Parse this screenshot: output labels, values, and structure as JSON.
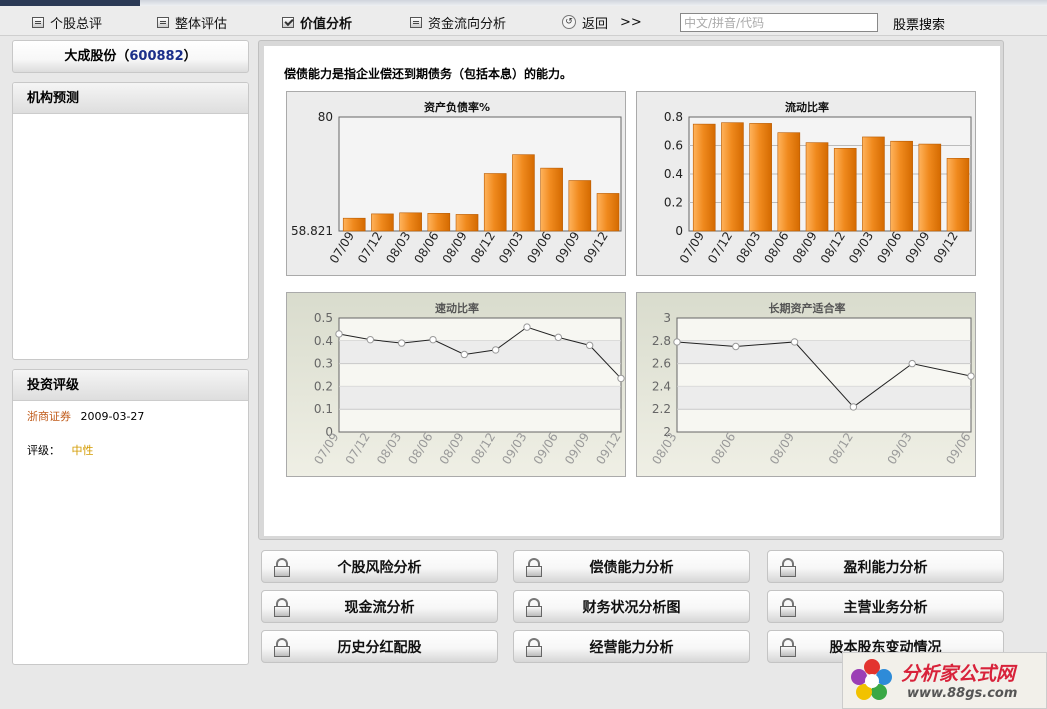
{
  "nav": {
    "items": [
      {
        "label": "个股总评"
      },
      {
        "label": "整体评估"
      },
      {
        "label": "价值分析",
        "active": true
      },
      {
        "label": "资金流向分析"
      },
      {
        "label": "返回"
      }
    ],
    "back_arrows": ">>",
    "search_placeholder": "中文/拼音/代码",
    "search_button": "股票搜索"
  },
  "stock": {
    "name": "大成股份",
    "code": "600882"
  },
  "institution_forecast": {
    "title": "机构预测"
  },
  "investment_rating": {
    "title": "投资评级",
    "broker": "浙商证券",
    "date": "2009-03-27",
    "rating_label": "评级：",
    "rating_value": "中性"
  },
  "intro_text": "偿债能力是指企业偿还到期债务（包括本息）的能力。",
  "chart_data": [
    {
      "type": "bar",
      "title": "资产负债率%",
      "categories": [
        "07/09",
        "07/12",
        "08/03",
        "08/06",
        "08/09",
        "08/12",
        "09/03",
        "09/06",
        "09/09",
        "09/12"
      ],
      "values": [
        61.2,
        62.0,
        62.2,
        62.1,
        61.9,
        69.5,
        73.0,
        70.5,
        68.2,
        65.8
      ],
      "ylim": [
        58.821,
        80
      ],
      "yticks": [
        "80",
        "58.821"
      ],
      "color": "#f08a1e"
    },
    {
      "type": "bar",
      "title": "流动比率",
      "categories": [
        "07/09",
        "07/12",
        "08/03",
        "08/06",
        "08/09",
        "08/12",
        "09/03",
        "09/06",
        "09/09",
        "09/12"
      ],
      "values": [
        0.75,
        0.76,
        0.755,
        0.69,
        0.62,
        0.58,
        0.66,
        0.63,
        0.61,
        0.51
      ],
      "ylim": [
        0,
        0.8
      ],
      "yticks": [
        "0.8",
        "0.6",
        "0.4",
        "0.2",
        "0"
      ],
      "color": "#f08a1e"
    },
    {
      "type": "line",
      "title": "速动比率",
      "categories": [
        "07/09",
        "07/12",
        "08/03",
        "08/06",
        "08/09",
        "08/12",
        "09/03",
        "09/06",
        "09/09",
        "09/12"
      ],
      "values": [
        0.43,
        0.405,
        0.39,
        0.405,
        0.34,
        0.36,
        0.46,
        0.415,
        0.38,
        0.235
      ],
      "ylim": [
        0,
        0.5
      ],
      "yticks": [
        "0.5",
        "0.4",
        "0.3",
        "0.2",
        "0.1",
        "0"
      ]
    },
    {
      "type": "line",
      "title": "长期资产适合率",
      "categories": [
        "08/03",
        "08/06",
        "08/09",
        "08/12",
        "09/03",
        "09/06"
      ],
      "values": [
        2.79,
        2.75,
        2.79,
        2.22,
        2.6,
        2.49
      ],
      "ylim": [
        2,
        3
      ],
      "yticks": [
        "3",
        "2.8",
        "2.6",
        "2.4",
        "2.2",
        "2"
      ]
    }
  ],
  "buttons": [
    {
      "label": "个股风险分析"
    },
    {
      "label": "偿债能力分析"
    },
    {
      "label": "盈利能力分析"
    },
    {
      "label": "现金流分析"
    },
    {
      "label": "财务状况分析图"
    },
    {
      "label": "主营业务分析"
    },
    {
      "label": "历史分红配股"
    },
    {
      "label": "经营能力分析"
    },
    {
      "label": "股本股东变动情况"
    }
  ],
  "watermark": {
    "text": "分析家公式网",
    "url": "www.88gs.com"
  }
}
